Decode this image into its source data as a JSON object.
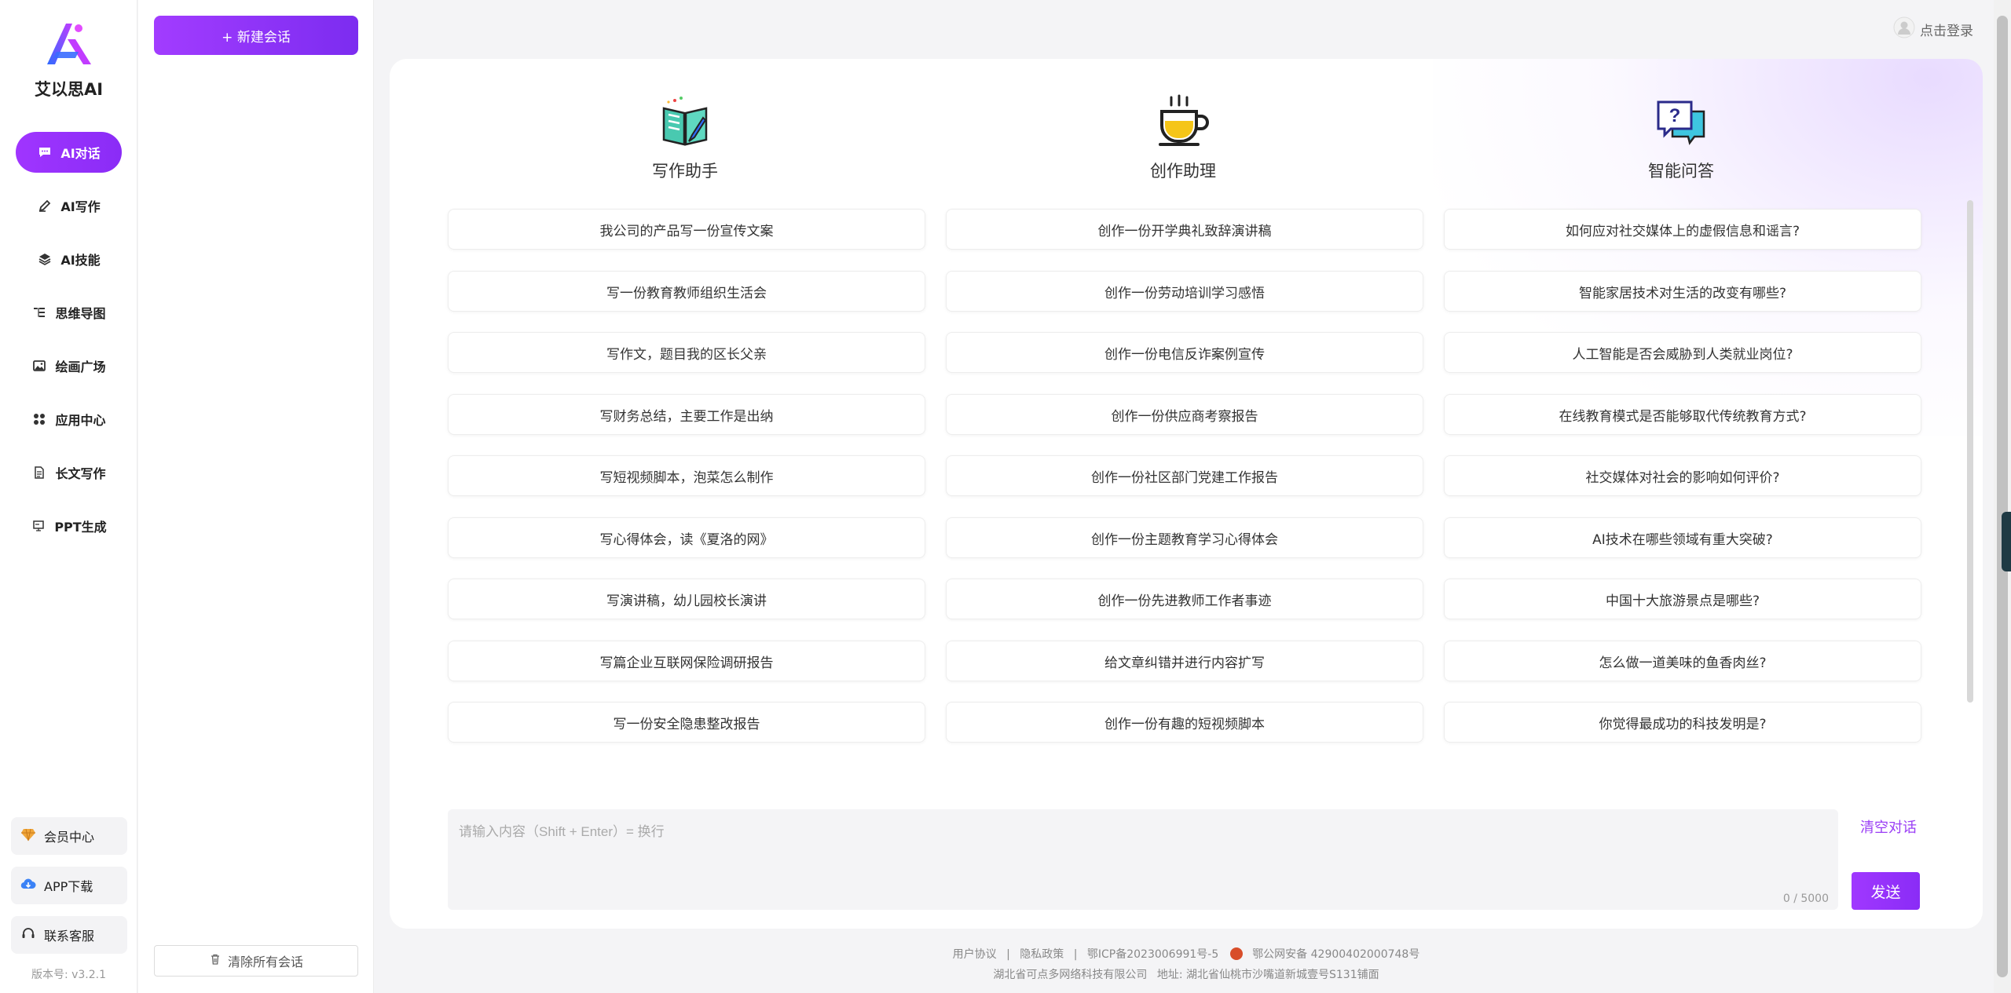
{
  "brand": {
    "name": "艾以思AI"
  },
  "nav": {
    "items": [
      {
        "label": "AI对话",
        "icon": "chat-bubble-icon"
      },
      {
        "label": "AI写作",
        "icon": "pen-icon"
      },
      {
        "label": "AI技能",
        "icon": "layers-icon"
      },
      {
        "label": "思维导图",
        "icon": "mindmap-icon"
      },
      {
        "label": "绘画广场",
        "icon": "image-icon"
      },
      {
        "label": "应用中心",
        "icon": "apps-grid-icon"
      },
      {
        "label": "长文写作",
        "icon": "document-icon"
      },
      {
        "label": "PPT生成",
        "icon": "presentation-icon"
      }
    ],
    "bottom": [
      {
        "label": "会员中心",
        "icon": "diamond-icon"
      },
      {
        "label": "APP下载",
        "icon": "cloud-download-icon"
      },
      {
        "label": "联系客服",
        "icon": "headset-icon"
      }
    ],
    "version": "版本号: v3.2.1"
  },
  "sessions": {
    "new_label": "+ 新建会话",
    "clear_label": "清除所有会话"
  },
  "header": {
    "login": "点击登录"
  },
  "categories": [
    {
      "title": "写作助手",
      "icon": "book-pencil-icon",
      "prompts": [
        "我公司的产品写一份宣传文案",
        "写一份教育教师组织生活会",
        "写作文，题目我的区长父亲",
        "写财务总结，主要工作是出纳",
        "写短视频脚本，泡菜怎么制作",
        "写心得体会，读《夏洛的网》",
        "写演讲稿，幼儿园校长演讲",
        "写篇企业互联网保险调研报告",
        "写一份安全隐患整改报告"
      ]
    },
    {
      "title": "创作助理",
      "icon": "coffee-cup-icon",
      "prompts": [
        "创作一份开学典礼致辞演讲稿",
        "创作一份劳动培训学习感悟",
        "创作一份电信反诈案例宣传",
        "创作一份供应商考察报告",
        "创作一份社区部门党建工作报告",
        "创作一份主题教育学习心得体会",
        "创作一份先进教师工作者事迹",
        "给文章纠错并进行内容扩写",
        "创作一份有趣的短视频脚本"
      ]
    },
    {
      "title": "智能问答",
      "icon": "question-bubble-icon",
      "prompts": [
        "如何应对社交媒体上的虚假信息和谣言?",
        "智能家居技术对生活的改变有哪些?",
        "人工智能是否会威胁到人类就业岗位?",
        "在线教育模式是否能够取代传统教育方式?",
        "社交媒体对社会的影响如何评价?",
        "AI技术在哪些领域有重大突破?",
        "中国十大旅游景点是哪些?",
        "怎么做一道美味的鱼香肉丝?",
        "你觉得最成功的科技发明是?"
      ]
    }
  ],
  "input": {
    "placeholder": "请输入内容（Shift + Enter）= 换行",
    "counter": "0 / 5000",
    "clear_label": "清空对话",
    "send_label": "发送"
  },
  "footer": {
    "links": [
      "用户协议",
      "|",
      "隐私政策",
      "|"
    ],
    "icp": "鄂ICP备2023006991号-5",
    "police": "鄂公网安备 42900402000748号",
    "company": "湖北省可点多网络科技有限公司",
    "address": "地址: 湖北省仙桃市沙嘴道新城壹号S131铺面"
  }
}
